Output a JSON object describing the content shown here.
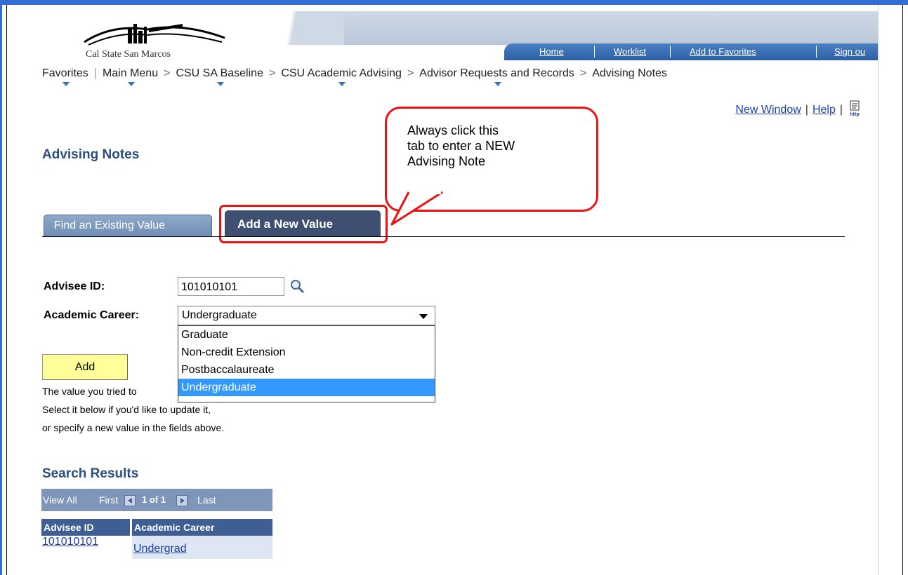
{
  "header": {
    "logo_text": "Cal State San Marcos",
    "nav": [
      "Home",
      "Worklist",
      "Add to Favorites",
      "Sign ou"
    ]
  },
  "breadcrumb": {
    "favorites": "Favorites",
    "items": [
      "Main Menu",
      "CSU SA Baseline",
      "CSU Academic Advising",
      "Advisor Requests and Records",
      "Advising Notes"
    ],
    "separator": ">"
  },
  "utility": {
    "new_window": "New Window",
    "help": "Help",
    "separator": "|",
    "http_icon_label": "http"
  },
  "page": {
    "title": "Advising Notes"
  },
  "callout": {
    "lines": [
      "Always click this",
      "tab to enter a NEW",
      "Advising Note"
    ]
  },
  "tabs": {
    "find": "Find an Existing Value",
    "add": "Add a New Value"
  },
  "form": {
    "advisee_label": "Advisee ID:",
    "advisee_value": "101010101",
    "career_label": "Academic Career:",
    "career_value": "Undergraduate",
    "career_options": [
      "Graduate",
      "Non-credit Extension",
      "Postbaccalaureate",
      "Undergraduate"
    ],
    "add_button": "Add"
  },
  "message": {
    "line1": "The value you tried to",
    "line2": "Select it below if you'd like to update it,",
    "line3": "or specify a new value in the fields above."
  },
  "results": {
    "title": "Search Results",
    "view_all": "View All",
    "first": "First",
    "page_info": "1 of 1",
    "last": "Last",
    "columns": [
      "Advisee ID",
      "Academic Career"
    ],
    "rows": [
      {
        "advisee_id": "101010101",
        "career": "Undergrad"
      }
    ]
  },
  "colors": {
    "frame_blue": "#2f6fd6",
    "title_blue": "#2a4e7e",
    "callout_red": "#ee1111",
    "selected_option": "#3399ff",
    "add_button_bg": "#ffff99",
    "grid_header": "#7f95b9",
    "column_header": "#3f5f94"
  }
}
